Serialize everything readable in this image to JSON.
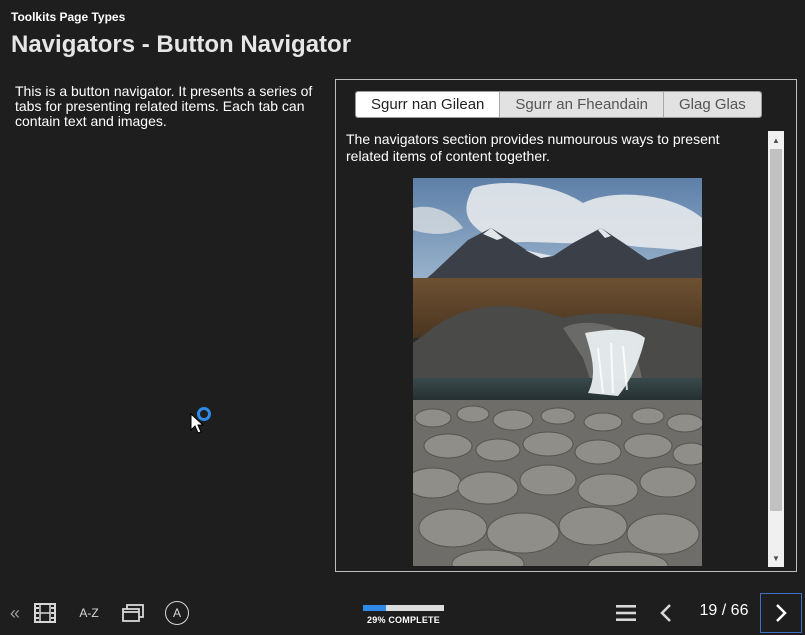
{
  "header": {
    "section_label": "Toolkits Page Types",
    "page_title": "Navigators - Button Navigator"
  },
  "intro": {
    "text": "This is a button navigator. It presents a series of tabs for presenting related items. Each tab can contain text and images."
  },
  "navigator": {
    "tabs": [
      {
        "label": "Sgurr nan Gilean",
        "active": true
      },
      {
        "label": "Sgurr an Fheandain",
        "active": false
      },
      {
        "label": "Glag Glas",
        "active": false
      }
    ],
    "content_text": "The navigators section provides numourous ways to present related items of content together."
  },
  "footer": {
    "collapse_icon": "double-chevron-left-icon",
    "glossary_label": "A-Z",
    "progress_percent": 29,
    "progress_label": "29% COMPLETE",
    "page_counter": "19 / 66"
  },
  "colors": {
    "background": "#1e1e1e",
    "progress_fill": "#2e8ae6",
    "next_border": "#3d6fc4",
    "cursor_ring": "#2e8ae6"
  }
}
